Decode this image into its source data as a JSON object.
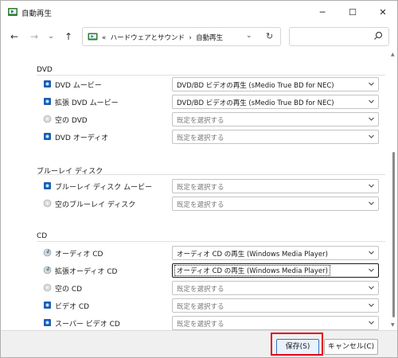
{
  "window": {
    "title": "自動再生"
  },
  "titlebar": {
    "minimize_glyph": "─",
    "maximize_glyph": "☐",
    "close_glyph": "✕"
  },
  "nav": {
    "back_glyph": "←",
    "forward_glyph": "→",
    "recent_glyph": "⌄",
    "up_glyph": "↑",
    "address_prefix": "«",
    "breadcrumb_1": "ハードウェアとサウンド",
    "breadcrumb_sep": "›",
    "breadcrumb_2": "自動再生",
    "address_dropdown_glyph": "⌄",
    "refresh_glyph": "↻"
  },
  "sections": {
    "dvd": {
      "title": "DVD",
      "rows": [
        {
          "label": "DVD ムービー",
          "value": "DVD/BD ビデオの再生 (sMedio True BD for NEC)"
        },
        {
          "label": "拡張 DVD ムービー",
          "value": "DVD/BD ビデオの再生 (sMedio True BD for NEC)"
        },
        {
          "label": "空の DVD",
          "value": "既定を選択する"
        },
        {
          "label": "DVD オーディオ",
          "value": "既定を選択する"
        }
      ]
    },
    "bluray": {
      "title": "ブルーレイ ディスク",
      "rows": [
        {
          "label": "ブルーレイ ディスク ムービー",
          "value": "既定を選択する"
        },
        {
          "label": "空のブルーレイ ディスク",
          "value": "既定を選択する"
        }
      ]
    },
    "cd": {
      "title": "CD",
      "rows": [
        {
          "label": "オーディオ CD",
          "value": "オーディオ CD の再生 (Windows Media Player)"
        },
        {
          "label": "拡張オーディオ CD",
          "value": "オーディオ CD の再生 (Windows Media Player)"
        },
        {
          "label": "空の CD",
          "value": "既定を選択する"
        },
        {
          "label": "ビデオ CD",
          "value": "既定を選択する"
        },
        {
          "label": "スーパー ビデオ CD",
          "value": "既定を選択する"
        }
      ]
    }
  },
  "footer": {
    "save_label": "保存(S)",
    "cancel_label": "キャンセル(C)"
  },
  "colors": {
    "highlight": "#e30613",
    "focus_border": "#3273c9"
  }
}
